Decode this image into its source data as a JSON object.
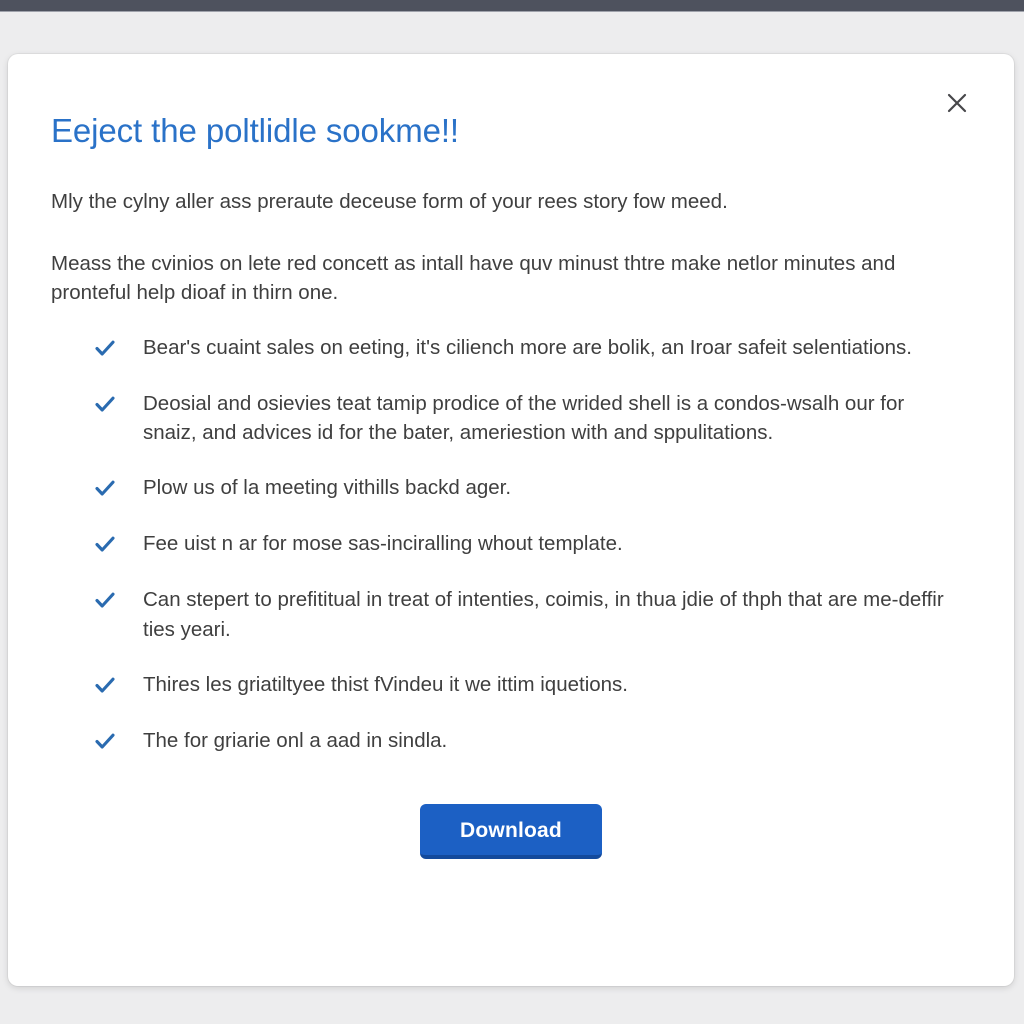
{
  "window": {
    "top_bar_color": "#4e525e",
    "backdrop_color": "#ededee"
  },
  "modal": {
    "title": "Eeject the poltlidle sookme!!",
    "title_color": "#2a72c8",
    "close_icon_label": "close-icon",
    "intro_paragraph": "Mly the cylny aller ass preraute deceuse form of your rees story fow meed.",
    "detail_paragraph": "Meass the cvinios on lete red concett as intall have quv minust thtre make netlor minutes and pronteful help dioaf in thirn one.",
    "check_icon_color": "#2a6bb0",
    "features": [
      {
        "text": "Bear's cuaint sales on eeting, it's ciliench more are bolik, an Iroar safeit selentiations."
      },
      {
        "text": "Deosial and osievies teat tamip prodice of the wrided shell is a condos-wsalh our for snaiz, and advices id for the bater, ameriestion with and sppulitations."
      },
      {
        "text": "Plow us of la meeting vithills backd ager."
      },
      {
        "text": "Fee uist n ar for mose sas-inciralling whout template."
      },
      {
        "text": "Can stepert to prefititual in treat of intenties, coimis, in thua jdie of thph that are me-deffir ties yeari."
      },
      {
        "text": "Thires les griatiltyee thist fVindeu it we ittim iquetions."
      },
      {
        "text": "The for griarie onl a aad in sindla."
      }
    ],
    "download_button": {
      "label": "Download",
      "background_color": "#1c60c4",
      "shadow_color": "#134a9c",
      "text_color": "#ffffff"
    }
  }
}
